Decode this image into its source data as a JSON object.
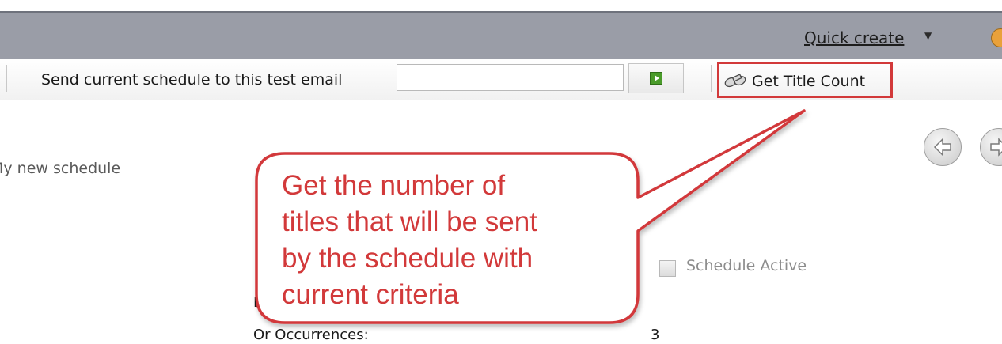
{
  "header": {
    "quick_create_label": "Quick create"
  },
  "toolbar": {
    "send_label": "Send current schedule to this test email",
    "email_value": "",
    "get_title_count_label": "Get Title Count"
  },
  "schedule": {
    "name": "My new schedule",
    "schedule_active_label": "Schedule Active",
    "schedule_active_checked": false,
    "ends_label": "E",
    "occurrences_label": "Or Occurrences:",
    "occurrences_value": "3"
  },
  "callout": {
    "lines": [
      "Get the number of",
      "titles that will be sent",
      "by the schedule with",
      "current criteria"
    ],
    "color": "#d2393a"
  },
  "colors": {
    "header_bg": "#9a9da7",
    "highlight_border": "#d2393a",
    "play_green": "#4a9b2a"
  },
  "icons": [
    "chevron-down-icon",
    "user-icon",
    "play-icon",
    "binoculars-icon",
    "back-arrow-icon",
    "forward-arrow-icon"
  ]
}
